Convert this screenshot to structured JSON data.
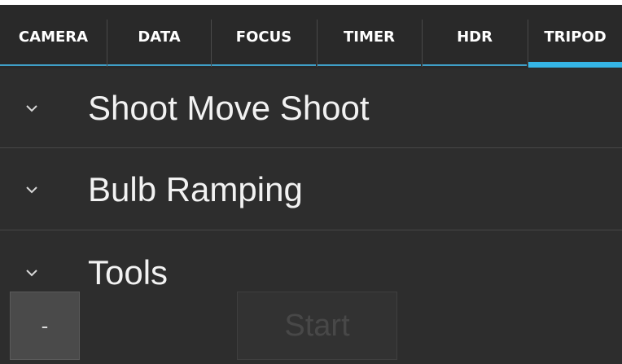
{
  "tabs": [
    {
      "label": "CAMERA",
      "active": false
    },
    {
      "label": "DATA",
      "active": false
    },
    {
      "label": "FOCUS",
      "active": false
    },
    {
      "label": "TIMER",
      "active": false
    },
    {
      "label": "HDR",
      "active": false
    },
    {
      "label": "TRIPOD",
      "active": true
    }
  ],
  "sections": [
    {
      "label": "Shoot Move Shoot",
      "icon": "chevron-down-icon"
    },
    {
      "label": "Bulb Ramping",
      "icon": "chevron-down-icon"
    },
    {
      "label": "Tools",
      "icon": "chevron-down-icon"
    }
  ],
  "buttons": {
    "minus_label": "-",
    "start_label": "Start",
    "start_enabled": false
  },
  "colors": {
    "background": "#2d2d2d",
    "accent": "#35b5e5",
    "text": "#ffffff"
  }
}
